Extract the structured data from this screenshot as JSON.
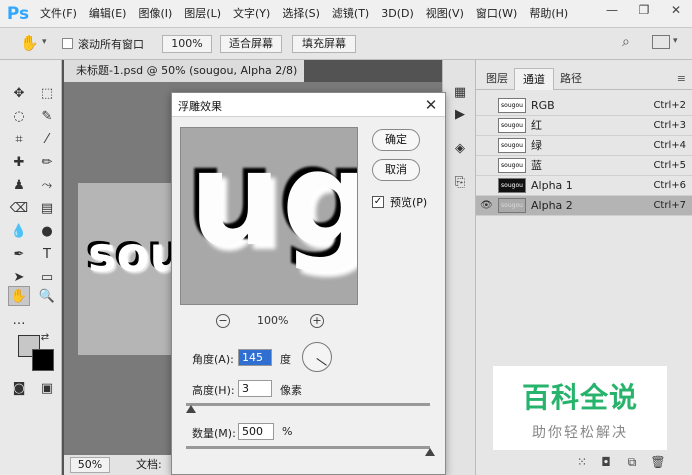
{
  "app": {
    "logo": "Ps"
  },
  "menu": [
    "文件(F)",
    "编辑(E)",
    "图像(I)",
    "图层(L)",
    "文字(Y)",
    "选择(S)",
    "滤镜(T)",
    "3D(D)",
    "视图(V)",
    "窗口(W)",
    "帮助(H)"
  ],
  "window_controls": {
    "minimize": "—",
    "restore": "❐",
    "close": "✕"
  },
  "options": {
    "scroll_all_label": "滚动所有窗口",
    "zoom_value": "100%",
    "fit_screen": "适合屏幕",
    "fill_screen": "填充屏幕"
  },
  "document": {
    "tab_title": "未标题-1.psd @ 50% (sougou, Alpha 2/8) *",
    "tab_close": "×",
    "canvas_text": "sou",
    "status_zoom": "50%",
    "status_info": "文档:"
  },
  "panel": {
    "tabs": [
      "图层",
      "通道",
      "路径"
    ],
    "active_tab": 1,
    "channels": [
      {
        "name": "RGB",
        "key": "Ctrl+2",
        "thumb": "sougou",
        "style": "light",
        "selected": false
      },
      {
        "name": "红",
        "key": "Ctrl+3",
        "thumb": "sougou",
        "style": "light",
        "selected": false
      },
      {
        "name": "绿",
        "key": "Ctrl+4",
        "thumb": "sougou",
        "style": "light",
        "selected": false
      },
      {
        "name": "蓝",
        "key": "Ctrl+5",
        "thumb": "sougou",
        "style": "light",
        "selected": false
      },
      {
        "name": "Alpha 1",
        "key": "Ctrl+6",
        "thumb": "sougou",
        "style": "dark",
        "selected": false
      },
      {
        "name": "Alpha 2",
        "key": "Ctrl+7",
        "thumb": "sougou",
        "style": "gray",
        "selected": true
      }
    ]
  },
  "dialog": {
    "title": "浮雕效果",
    "close": "✕",
    "ok": "确定",
    "cancel": "取消",
    "preview_label": "预览(P)",
    "preview_checked": true,
    "preview_text": "ug",
    "zoom": "100%",
    "zoom_out": "−",
    "zoom_in": "+",
    "angle_label": "角度(A):",
    "angle_value": "145",
    "angle_unit": "度",
    "height_label": "高度(H):",
    "height_value": "3",
    "height_unit": "像素",
    "amount_label": "数量(M):",
    "amount_value": "500",
    "amount_unit": "%"
  },
  "watermark": {
    "title": "百科全说",
    "subtitle": "助你轻松解决"
  },
  "colors": {
    "ps_blue": "#31a8ff",
    "watermark_green": "#27b36b",
    "selection_blue": "#2f6fd1"
  }
}
